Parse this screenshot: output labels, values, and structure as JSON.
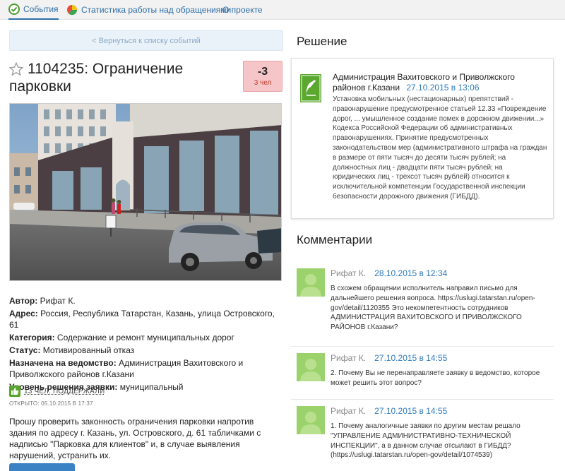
{
  "nav": {
    "items": [
      {
        "label": "События",
        "icon": "check-circle-icon"
      },
      {
        "label": "Статистика работы над обращениями",
        "icon": "pie-chart-icon"
      },
      {
        "label": "О проекте",
        "icon": ""
      }
    ]
  },
  "back_link": "< Вернуться к списку событий",
  "issue": {
    "title": "1104235: Ограничение парковки",
    "vote_score": "-3",
    "vote_count": "3 чел",
    "author_label": "Автор:",
    "author": "Рифат К.",
    "address_label": "Адрес:",
    "address": "Россия, Республика Татарстан, Казань, улица Островского, 61",
    "category_label": "Категория:",
    "category": "Содержание и ремонт муниципальных дорог",
    "status_label": "Статус:",
    "status": "Мотивированный отказ",
    "assigned_label": "Назначена на ведомство:",
    "assigned": "Администрация Вахитовского и Приволжского районов г.Казани",
    "level_label": "Уровень решения заявки:",
    "level": "муниципальный",
    "support": "13 ЧЕЛ. ПОДДЕРЖАЛИ",
    "opened": "ОТКРЫТО: 05.10.2015 В 17:37",
    "description": "Прошу проверить законность ограничения парковки напротив здания по адресу г. Казань, ул. Островского, д. 61 табличками с надписью \"Парковка для клиентов\" и, в случае выявления нарушений, устранить их."
  },
  "decision": {
    "heading": "Решение",
    "author": "Администрация Вахитовского и Приволжского районов г.Казани",
    "date": "27.10.2015 в 13:06",
    "text": "Установка мобильных (нестационарных) препятствий - правонарушение предусмотренное статьей 12.33 «Повреждение дорог, ... умышленное создание помех в дорожном движении...» Кодекса Российской Федерации об административных правонарушениях. Принятие предусмотренных законодательством мер (административного штрафа на граждан в размере от пяти тысяч до десяти тысяч рублей; на должностных лиц - двадцати пяти тысяч рублей; на юридических лиц - трехсот тысяч рублей) относится к исключительной компетенции Государственной инспекции безопасности дорожного движения (ГИБДД)."
  },
  "comments": {
    "heading": "Комментарии",
    "items": [
      {
        "author": "Рифат К.",
        "date": "28.10.2015 в 12:34",
        "text": "В схожем обращении исполнитель направил письмо для дальнейшего решения вопроса. https://uslugi.tatarstan.ru/open-gov/detail/1120355 Это некомпетентность сотрудников АДМИНИСТРАЦИЯ ВАХИТОВСКОГО И ПРИВОЛЖСКОГО РАЙОНОВ г.Казани?"
      },
      {
        "author": "Рифат К.",
        "date": "27.10.2015 в 14:55",
        "text": "2. Почему Вы не перенаправляете заявку в ведомство, которое может решить этот вопрос?"
      },
      {
        "author": "Рифат К.",
        "date": "27.10.2015 в 14:55",
        "text": "1. Почему аналогичные заявки по другим местам решало \"УПРАВЛЕНИЕ АДМИНИСТРАТИВНО-ТЕХНИЧЕСКОЙ ИНСПЕКЦИИ\", а в данном случае отсылают в ГИБДД? (https://uslugi.tatarstan.ru/open-gov/detail/1074539)"
      }
    ]
  },
  "colors": {
    "link": "#2e7bbf",
    "vote_bg": "#f6c5c8",
    "avatar": "#9bd26b",
    "coat": "#5ba82f"
  }
}
